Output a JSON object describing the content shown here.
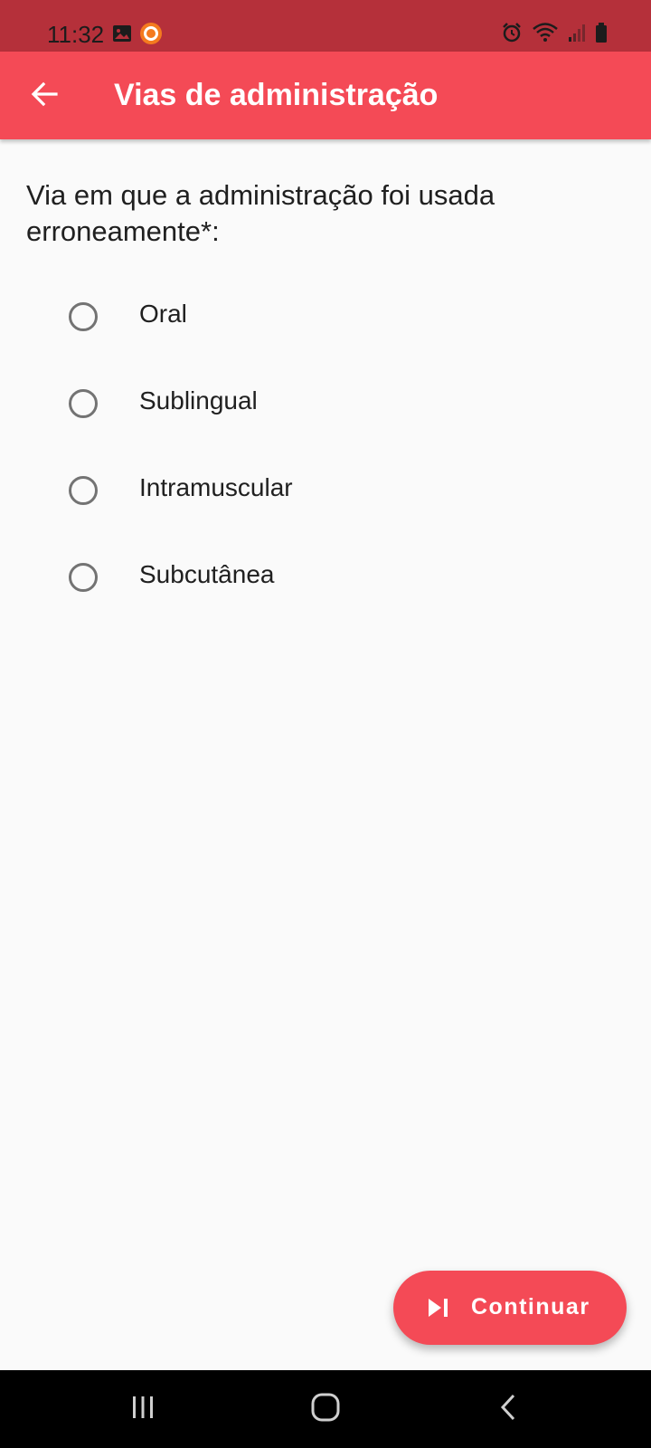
{
  "status_bar": {
    "time": "11:32",
    "left_icons": [
      "image-icon",
      "recorder-icon"
    ],
    "right_icons": [
      "alarm-icon",
      "wifi-icon",
      "signal-icon",
      "battery-icon"
    ],
    "colors": {
      "background": "#b5303a"
    }
  },
  "app_bar": {
    "title": "Vias de administração",
    "back_icon": "arrow-left-icon",
    "colors": {
      "background": "#f44a56",
      "text": "#ffffff"
    }
  },
  "form": {
    "question": "Via em que a administração foi usada erroneamente*:",
    "options": [
      {
        "label": "Oral",
        "selected": false
      },
      {
        "label": "Sublingual",
        "selected": false
      },
      {
        "label": "Intramuscular",
        "selected": false
      },
      {
        "label": "Subcutânea",
        "selected": false
      }
    ]
  },
  "fab": {
    "label": "Continuar",
    "icon": "skip-next-icon",
    "colors": {
      "background": "#f44a56"
    }
  },
  "nav_bar": {
    "buttons": [
      "recent-apps-icon",
      "home-icon",
      "back-icon"
    ]
  }
}
